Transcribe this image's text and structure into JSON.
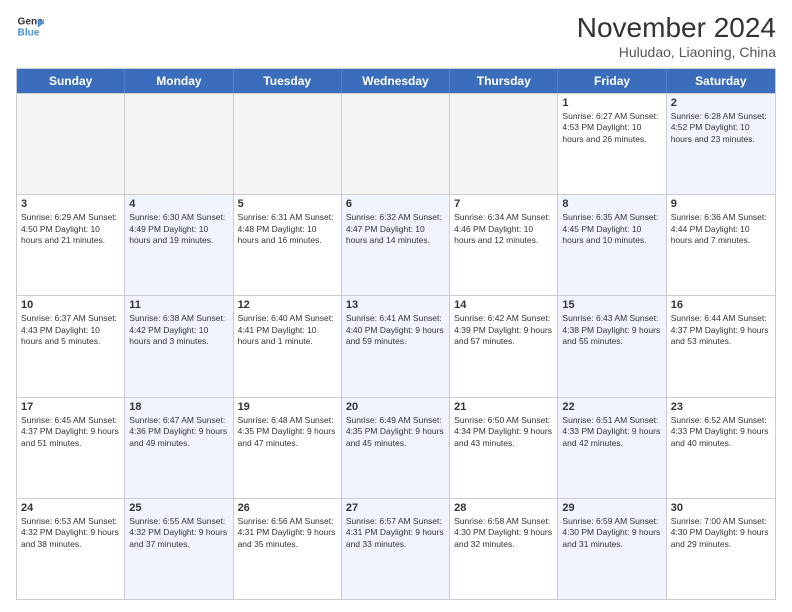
{
  "logo": {
    "line1": "General",
    "line2": "Blue"
  },
  "title": "November 2024",
  "subtitle": "Huludao, Liaoning, China",
  "weekdays": [
    "Sunday",
    "Monday",
    "Tuesday",
    "Wednesday",
    "Thursday",
    "Friday",
    "Saturday"
  ],
  "rows": [
    [
      {
        "day": "",
        "info": "",
        "empty": true
      },
      {
        "day": "",
        "info": "",
        "empty": true
      },
      {
        "day": "",
        "info": "",
        "empty": true
      },
      {
        "day": "",
        "info": "",
        "empty": true
      },
      {
        "day": "",
        "info": "",
        "empty": true
      },
      {
        "day": "1",
        "info": "Sunrise: 6:27 AM\nSunset: 4:53 PM\nDaylight: 10 hours and 26 minutes.",
        "alt": false
      },
      {
        "day": "2",
        "info": "Sunrise: 6:28 AM\nSunset: 4:52 PM\nDaylight: 10 hours and 23 minutes.",
        "alt": true
      }
    ],
    [
      {
        "day": "3",
        "info": "Sunrise: 6:29 AM\nSunset: 4:50 PM\nDaylight: 10 hours and 21 minutes.",
        "alt": false
      },
      {
        "day": "4",
        "info": "Sunrise: 6:30 AM\nSunset: 4:49 PM\nDaylight: 10 hours and 19 minutes.",
        "alt": true
      },
      {
        "day": "5",
        "info": "Sunrise: 6:31 AM\nSunset: 4:48 PM\nDaylight: 10 hours and 16 minutes.",
        "alt": false
      },
      {
        "day": "6",
        "info": "Sunrise: 6:32 AM\nSunset: 4:47 PM\nDaylight: 10 hours and 14 minutes.",
        "alt": true
      },
      {
        "day": "7",
        "info": "Sunrise: 6:34 AM\nSunset: 4:46 PM\nDaylight: 10 hours and 12 minutes.",
        "alt": false
      },
      {
        "day": "8",
        "info": "Sunrise: 6:35 AM\nSunset: 4:45 PM\nDaylight: 10 hours and 10 minutes.",
        "alt": true
      },
      {
        "day": "9",
        "info": "Sunrise: 6:36 AM\nSunset: 4:44 PM\nDaylight: 10 hours and 7 minutes.",
        "alt": false
      }
    ],
    [
      {
        "day": "10",
        "info": "Sunrise: 6:37 AM\nSunset: 4:43 PM\nDaylight: 10 hours and 5 minutes.",
        "alt": false
      },
      {
        "day": "11",
        "info": "Sunrise: 6:38 AM\nSunset: 4:42 PM\nDaylight: 10 hours and 3 minutes.",
        "alt": true
      },
      {
        "day": "12",
        "info": "Sunrise: 6:40 AM\nSunset: 4:41 PM\nDaylight: 10 hours and 1 minute.",
        "alt": false
      },
      {
        "day": "13",
        "info": "Sunrise: 6:41 AM\nSunset: 4:40 PM\nDaylight: 9 hours and 59 minutes.",
        "alt": true
      },
      {
        "day": "14",
        "info": "Sunrise: 6:42 AM\nSunset: 4:39 PM\nDaylight: 9 hours and 57 minutes.",
        "alt": false
      },
      {
        "day": "15",
        "info": "Sunrise: 6:43 AM\nSunset: 4:38 PM\nDaylight: 9 hours and 55 minutes.",
        "alt": true
      },
      {
        "day": "16",
        "info": "Sunrise: 6:44 AM\nSunset: 4:37 PM\nDaylight: 9 hours and 53 minutes.",
        "alt": false
      }
    ],
    [
      {
        "day": "17",
        "info": "Sunrise: 6:45 AM\nSunset: 4:37 PM\nDaylight: 9 hours and 51 minutes.",
        "alt": false
      },
      {
        "day": "18",
        "info": "Sunrise: 6:47 AM\nSunset: 4:36 PM\nDaylight: 9 hours and 49 minutes.",
        "alt": true
      },
      {
        "day": "19",
        "info": "Sunrise: 6:48 AM\nSunset: 4:35 PM\nDaylight: 9 hours and 47 minutes.",
        "alt": false
      },
      {
        "day": "20",
        "info": "Sunrise: 6:49 AM\nSunset: 4:35 PM\nDaylight: 9 hours and 45 minutes.",
        "alt": true
      },
      {
        "day": "21",
        "info": "Sunrise: 6:50 AM\nSunset: 4:34 PM\nDaylight: 9 hours and 43 minutes.",
        "alt": false
      },
      {
        "day": "22",
        "info": "Sunrise: 6:51 AM\nSunset: 4:33 PM\nDaylight: 9 hours and 42 minutes.",
        "alt": true
      },
      {
        "day": "23",
        "info": "Sunrise: 6:52 AM\nSunset: 4:33 PM\nDaylight: 9 hours and 40 minutes.",
        "alt": false
      }
    ],
    [
      {
        "day": "24",
        "info": "Sunrise: 6:53 AM\nSunset: 4:32 PM\nDaylight: 9 hours and 38 minutes.",
        "alt": false
      },
      {
        "day": "25",
        "info": "Sunrise: 6:55 AM\nSunset: 4:32 PM\nDaylight: 9 hours and 37 minutes.",
        "alt": true
      },
      {
        "day": "26",
        "info": "Sunrise: 6:56 AM\nSunset: 4:31 PM\nDaylight: 9 hours and 35 minutes.",
        "alt": false
      },
      {
        "day": "27",
        "info": "Sunrise: 6:57 AM\nSunset: 4:31 PM\nDaylight: 9 hours and 33 minutes.",
        "alt": true
      },
      {
        "day": "28",
        "info": "Sunrise: 6:58 AM\nSunset: 4:30 PM\nDaylight: 9 hours and 32 minutes.",
        "alt": false
      },
      {
        "day": "29",
        "info": "Sunrise: 6:59 AM\nSunset: 4:30 PM\nDaylight: 9 hours and 31 minutes.",
        "alt": true
      },
      {
        "day": "30",
        "info": "Sunrise: 7:00 AM\nSunset: 4:30 PM\nDaylight: 9 hours and 29 minutes.",
        "alt": false
      }
    ]
  ]
}
